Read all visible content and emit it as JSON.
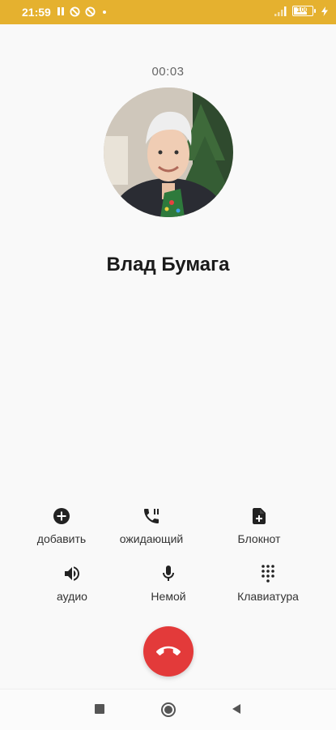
{
  "status_bar": {
    "time": "21:59",
    "battery_level": "100",
    "icons": [
      "pause-icon",
      "data-saver-icon",
      "data-saver-icon",
      "dot-icon",
      "signal-icon",
      "battery-icon",
      "charging-icon"
    ]
  },
  "call": {
    "duration": "00:03",
    "caller_name": "Влад Бумага"
  },
  "controls": {
    "add": "добавить",
    "hold": "ожидающий",
    "notes": "Блокнот",
    "audio": "аудио",
    "mute": "Немой",
    "keypad": "Клавиатура"
  },
  "colors": {
    "status_bar": "#e5b12f",
    "end_call": "#e33a3a",
    "background": "#f9f9f9"
  }
}
